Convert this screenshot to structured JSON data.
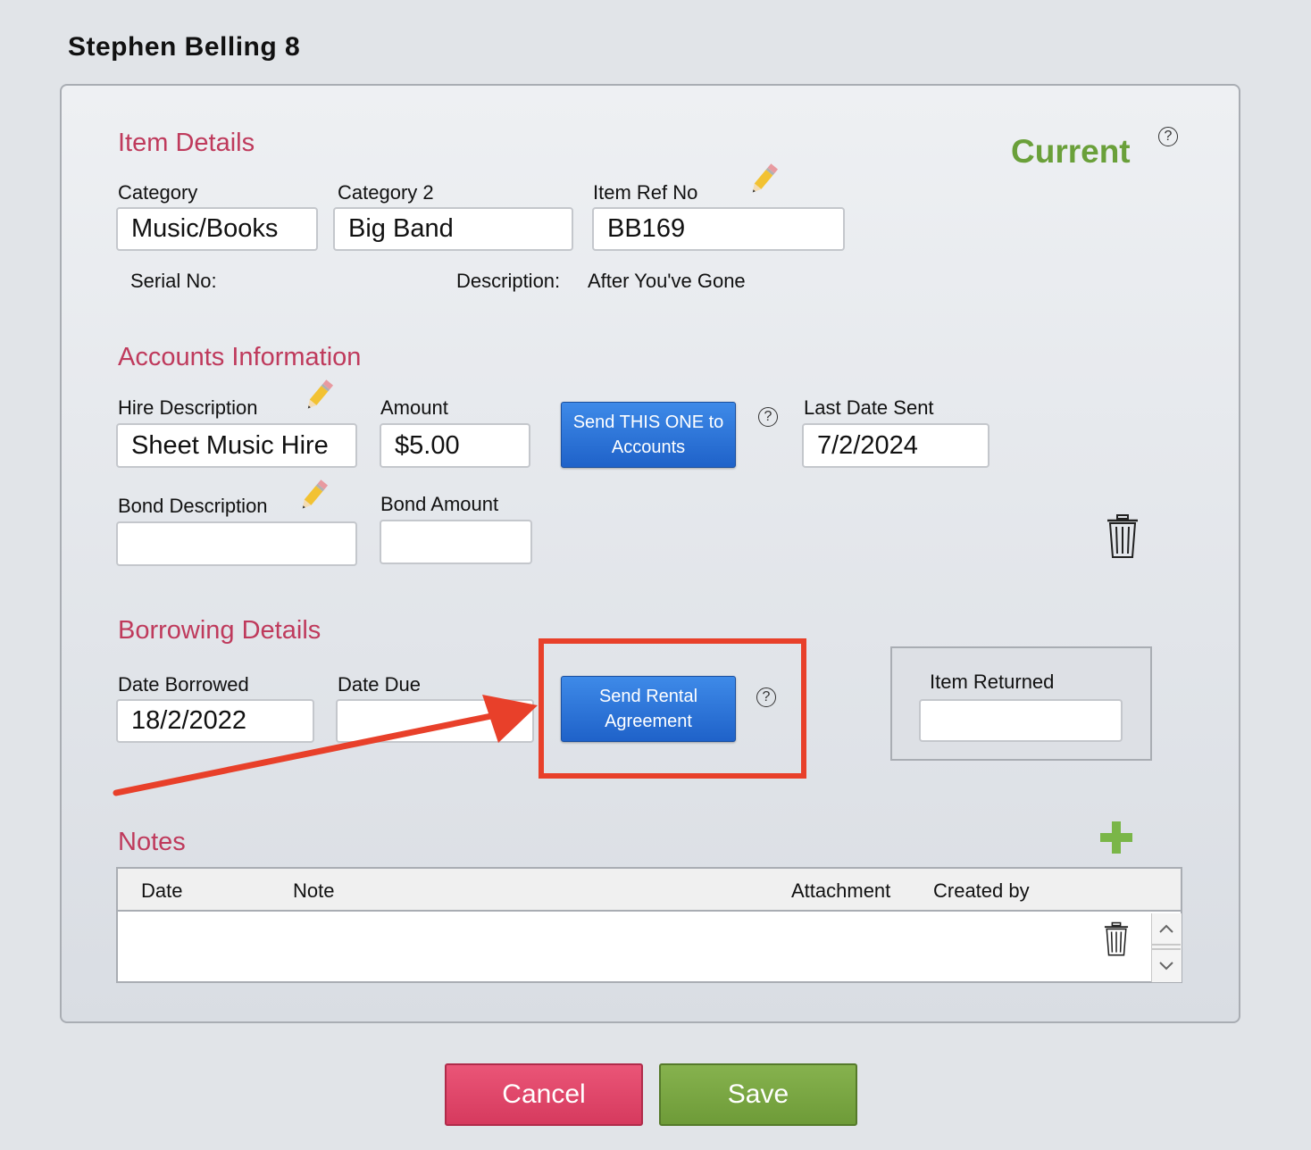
{
  "page": {
    "title": "Stephen Belling 8"
  },
  "status": {
    "label": "Current",
    "help": "?"
  },
  "item_details": {
    "title": "Item Details",
    "category_label": "Category",
    "category_value": "Music/Books",
    "category2_label": "Category 2",
    "category2_value": "Big Band",
    "ref_label": "Item Ref No",
    "ref_value": "BB169",
    "serial_label": "Serial No:",
    "serial_value": "",
    "description_label": "Description:",
    "description_value": "After You've Gone"
  },
  "accounts": {
    "title": "Accounts Information",
    "hire_desc_label": "Hire Description",
    "hire_desc_value": "Sheet Music Hire",
    "amount_label": "Amount",
    "amount_value": "$5.00",
    "send_button_line1": "Send THIS ONE to",
    "send_button_line2": "Accounts",
    "help": "?",
    "last_date_label": "Last Date Sent",
    "last_date_value": "7/2/2024",
    "bond_desc_label": "Bond Description",
    "bond_desc_value": "",
    "bond_amount_label": "Bond Amount",
    "bond_amount_value": ""
  },
  "borrowing": {
    "title": "Borrowing Details",
    "date_borrowed_label": "Date Borrowed",
    "date_borrowed_value": "18/2/2022",
    "date_due_label": "Date Due",
    "date_due_value": "",
    "rental_button_line1": "Send Rental",
    "rental_button_line2": "Agreement",
    "help": "?",
    "item_returned_label": "Item Returned",
    "item_returned_value": ""
  },
  "notes": {
    "title": "Notes",
    "columns": [
      "Date",
      "Note",
      "Attachment",
      "Created by"
    ]
  },
  "footer": {
    "cancel_label": "Cancel",
    "save_label": "Save"
  },
  "colors": {
    "section_title": "#bf3a5c",
    "status": "#6aa03a",
    "annotation": "#e8402a",
    "primary_button": "#2a72d8",
    "cancel": "#e04a6e",
    "save": "#7aa645"
  },
  "icons": [
    "pencil-icon",
    "trash-icon",
    "help-icon",
    "add-icon",
    "chevron-up-icon",
    "chevron-down-icon"
  ]
}
